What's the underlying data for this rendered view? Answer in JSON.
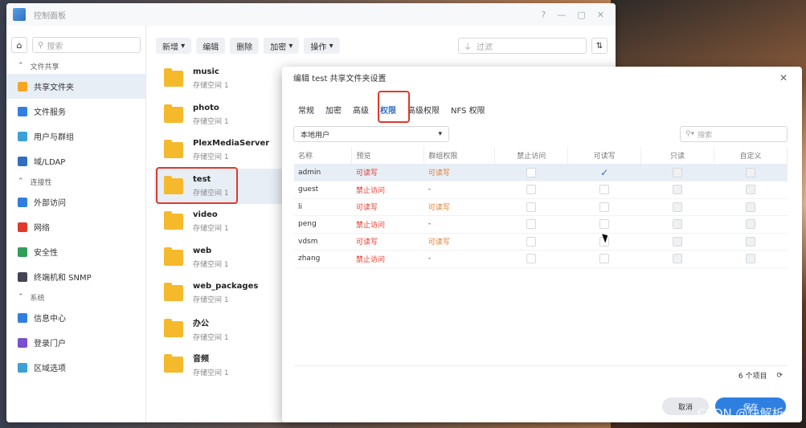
{
  "window": {
    "title": "控制面板"
  },
  "sidebar": {
    "search_placeholder": "搜索",
    "sections": [
      {
        "title": "文件共享",
        "items": [
          {
            "label": "共享文件夹",
            "icon": "shared-folder-icon",
            "active": true
          },
          {
            "label": "文件服务",
            "icon": "file-service-icon"
          },
          {
            "label": "用户与群组",
            "icon": "users-icon"
          },
          {
            "label": "域/LDAP",
            "icon": "domain-icon"
          }
        ]
      },
      {
        "title": "连接性",
        "items": [
          {
            "label": "外部访问",
            "icon": "external-access-icon"
          },
          {
            "label": "网络",
            "icon": "network-icon"
          },
          {
            "label": "安全性",
            "icon": "security-icon"
          },
          {
            "label": "终端机和 SNMP",
            "icon": "terminal-icon"
          }
        ]
      },
      {
        "title": "系统",
        "items": [
          {
            "label": "信息中心",
            "icon": "info-icon"
          },
          {
            "label": "登录门户",
            "icon": "login-portal-icon"
          },
          {
            "label": "区域选项",
            "icon": "region-icon"
          }
        ]
      }
    ]
  },
  "toolbar": {
    "create": "新增",
    "edit": "编辑",
    "delete": "删除",
    "encrypt": "加密",
    "action": "操作",
    "filter_placeholder": "过滤"
  },
  "folders": [
    {
      "name": "music",
      "sub": "存储空间 1"
    },
    {
      "name": "photo",
      "sub": "存储空间 1"
    },
    {
      "name": "PlexMediaServer",
      "sub": "存储空间 1"
    },
    {
      "name": "test",
      "sub": "存储空间 1",
      "selected": true
    },
    {
      "name": "video",
      "sub": "存储空间 1"
    },
    {
      "name": "web",
      "sub": "存储空间 1"
    },
    {
      "name": "web_packages",
      "sub": "存储空间 1"
    },
    {
      "name": "办公",
      "sub": "存储空间 1"
    },
    {
      "name": "音频",
      "sub": "存储空间 1"
    }
  ],
  "dialog": {
    "title": "编辑 test 共享文件夹设置",
    "tabs": [
      "常规",
      "加密",
      "高级",
      "权限",
      "高级权限",
      "NFS 权限"
    ],
    "active_tab": 3,
    "user_type": "本地用户",
    "search_placeholder": "搜索",
    "columns": [
      "名称",
      "预览",
      "群组权限",
      "禁止访问",
      "可读写",
      "只读",
      "自定义"
    ],
    "rows": [
      {
        "name": "admin",
        "preview": "可读写",
        "group": "可读写",
        "preview_color": "red",
        "group_color": "orange",
        "rw": true
      },
      {
        "name": "guest",
        "preview": "禁止访问",
        "group": "-",
        "preview_color": "red",
        "group_color": "",
        "rw": false
      },
      {
        "name": "li",
        "preview": "可读写",
        "group": "可读写",
        "preview_color": "red",
        "group_color": "orange",
        "rw": false
      },
      {
        "name": "peng",
        "preview": "禁止访问",
        "group": "-",
        "preview_color": "red",
        "group_color": "",
        "rw": false
      },
      {
        "name": "vdsm",
        "preview": "可读写",
        "group": "可读写",
        "preview_color": "red",
        "group_color": "orange",
        "rw": false
      },
      {
        "name": "zhang",
        "preview": "禁止访问",
        "group": "-",
        "preview_color": "red",
        "group_color": "",
        "rw": false
      }
    ],
    "item_count": "6 个项目",
    "cancel": "取消",
    "save": "保存"
  },
  "watermark": "CSDN @快解析",
  "colors": {
    "accent": "#2f6fc0",
    "highlight": "#e0392b",
    "folder": "#f5b92c"
  }
}
